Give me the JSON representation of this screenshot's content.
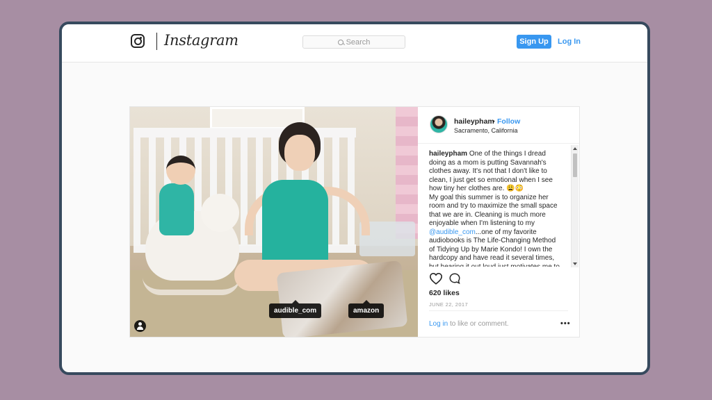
{
  "header": {
    "brand": "Instagram",
    "search_placeholder": "Search",
    "signup_label": "Sign Up",
    "login_label": "Log In"
  },
  "post": {
    "photo_tags": [
      "audible_com",
      "amazon"
    ],
    "username": "haileypham",
    "follow_separator": "•",
    "follow_label": "Follow",
    "location": "Sacramento, California",
    "caption": {
      "author": "haileypham",
      "part1": "One of the things I dread doing as a mom is putting Savannah's clothes away. It's not that I don't like to clean, I just get so emotional when I see how tiny her clothes are. 😩😳",
      "part2": "My goal this summer is to organize her room and try to maximize the small space that we are in. Cleaning is much more enjoyable when I'm listening to my ",
      "mention": "@audible_com",
      "part3": "...one of my favorite audiobooks is The Life-Changing Method of Tidying Up by Marie Kondo! I own the hardcopy and have read it several times, but hearing it out loud just motivates me to"
    },
    "likes": "620 likes",
    "date": "JUNE 22, 2017",
    "login_link": "Log in",
    "comment_prompt": " to like or comment.",
    "more_label": "•••"
  },
  "icons": [
    "instagram-glyph-icon",
    "search-icon",
    "user-tag-icon",
    "heart-icon",
    "comment-icon",
    "more-options-icon"
  ]
}
